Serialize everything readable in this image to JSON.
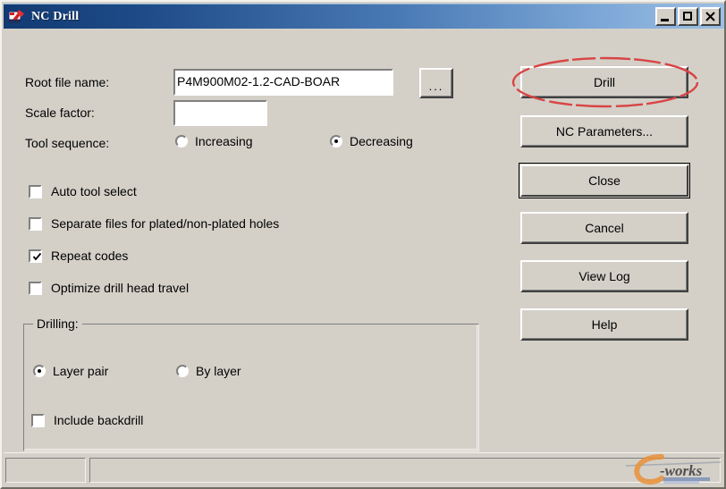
{
  "window": {
    "title": "NC Drill",
    "icon": "nc-drill-app-icon",
    "background_color": "#d4d0c8",
    "titlebar_gradient_from": "#123a73",
    "titlebar_gradient_to": "#9dc0e4",
    "controls": {
      "minimize": "minimize-icon",
      "maximize": "maximize-icon",
      "close": "close-icon"
    }
  },
  "form": {
    "root_file": {
      "label": "Root file name:",
      "value": "P4M900M02-1.2-CAD-BOAR",
      "placeholder": "",
      "browse_label": "..."
    },
    "scale_factor": {
      "label": "Scale factor:",
      "value": "",
      "placeholder": ""
    },
    "tool_sequence": {
      "label": "Tool sequence:",
      "options": [
        {
          "label": "Increasing",
          "selected": false
        },
        {
          "label": "Decreasing",
          "selected": true
        }
      ],
      "selected": "Decreasing"
    },
    "checkboxes": [
      {
        "label": "Auto tool select",
        "checked": false
      },
      {
        "label": "Separate files for plated/non-plated holes",
        "checked": false
      },
      {
        "label": "Repeat codes",
        "checked": true
      },
      {
        "label": "Optimize drill head travel",
        "checked": false
      }
    ],
    "drilling_group": {
      "title": "Drilling:",
      "mode_options": [
        {
          "label": "Layer pair",
          "selected": true
        },
        {
          "label": "By layer",
          "selected": false
        }
      ],
      "selected_mode": "Layer pair",
      "include_backdrill": {
        "label": "Include backdrill",
        "checked": false
      }
    }
  },
  "buttons": [
    {
      "label": "Drill",
      "default": false,
      "annotated": true
    },
    {
      "label": "NC Parameters...",
      "default": false,
      "annotated": false
    },
    {
      "label": "Close",
      "default": true,
      "annotated": false
    },
    {
      "label": "Cancel",
      "default": false,
      "annotated": false
    },
    {
      "label": "View Log",
      "default": false,
      "annotated": false
    },
    {
      "label": "Help",
      "default": false,
      "annotated": false
    }
  ],
  "annotation": {
    "shape": "ellipse",
    "color": "#d94444",
    "target": "Drill"
  },
  "statusbar": {
    "pane_left": "",
    "pane_right": ""
  },
  "watermark": {
    "text_c": "C",
    "text_works": "-works",
    "color_c": "#e8913a",
    "color_works": "#4a4a4a"
  }
}
